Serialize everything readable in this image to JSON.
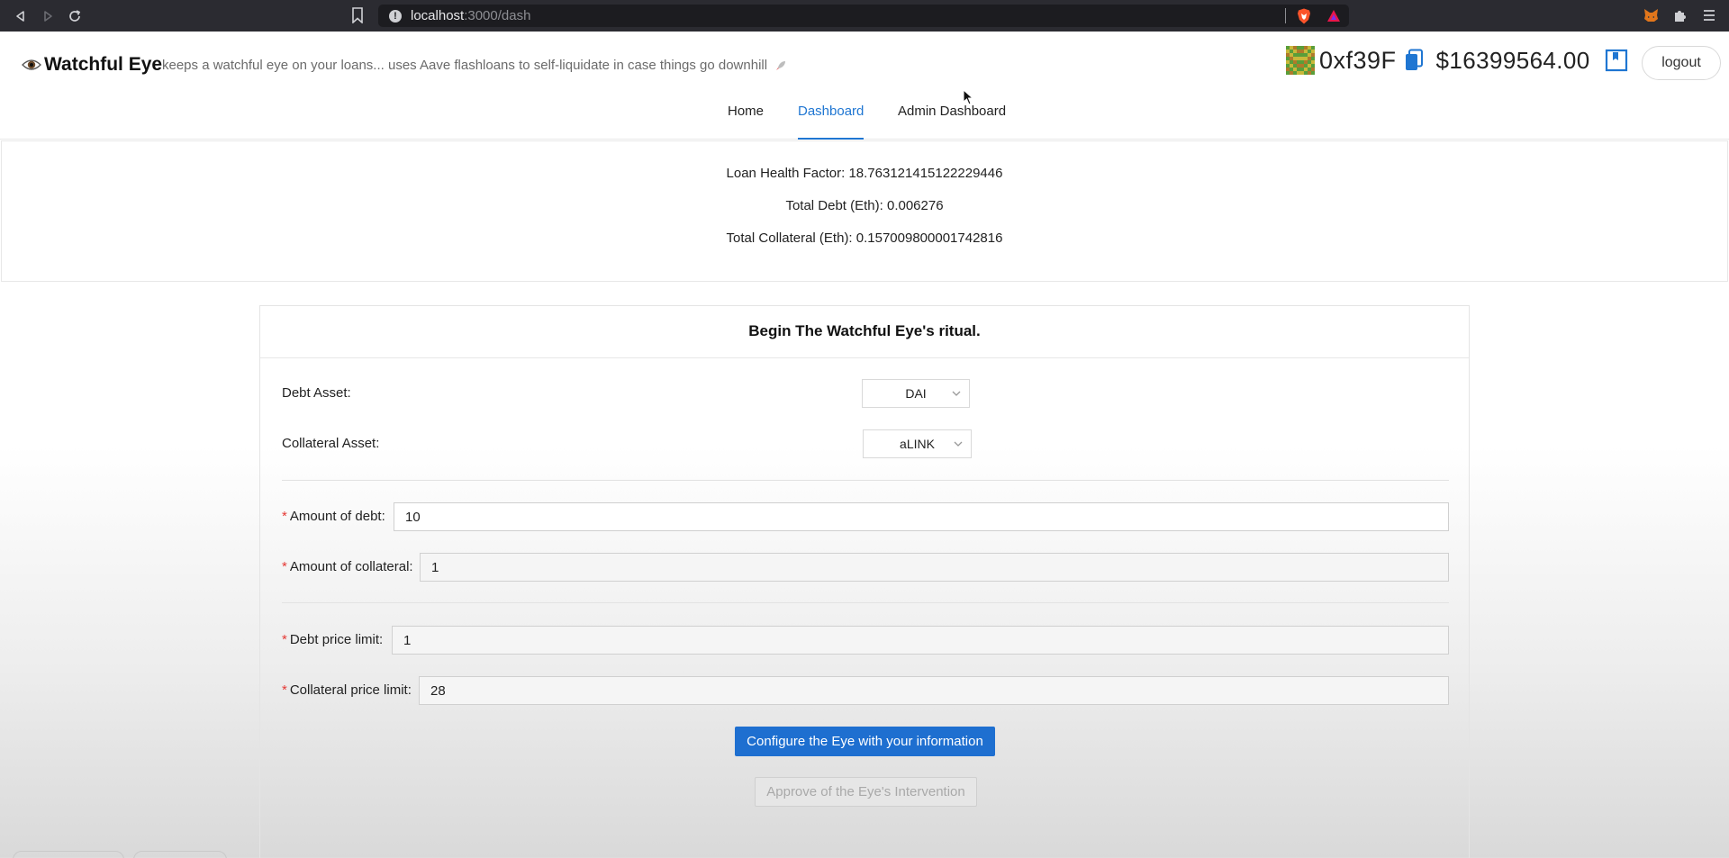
{
  "browser": {
    "url_host": "localhost",
    "url_path": ":3000/dash"
  },
  "app": {
    "title": "Watchful Eye",
    "tagline": "keeps a watchful eye on your loans... uses Aave flashloans to self-liquidate in case things go downhill",
    "address": "0xf39F",
    "balance": "$16399564.00",
    "logout_label": "logout"
  },
  "nav": {
    "tabs": [
      {
        "label": "Home",
        "active": false
      },
      {
        "label": "Dashboard",
        "active": true
      },
      {
        "label": "Admin Dashboard",
        "active": false
      }
    ]
  },
  "stats": {
    "health_factor": "Loan Health Factor: 18.763121415122229446",
    "total_debt": "Total Debt (Eth): 0.006276",
    "total_collateral": "Total Collateral (Eth): 0.157009800001742816"
  },
  "form": {
    "heading": "Begin The Watchful Eye's ritual.",
    "debt_asset_label": "Debt Asset",
    "debt_asset_value": "DAI",
    "collateral_asset_label": "Collateral Asset",
    "collateral_asset_value": "aLINK",
    "amount_debt_label": "Amount of debt",
    "amount_debt_value": "10",
    "amount_collateral_label": "Amount of collateral",
    "amount_collateral_value": "1",
    "debt_price_limit_label": "Debt price limit",
    "debt_price_limit_value": "1",
    "collateral_price_limit_label": "Collateral price limit",
    "collateral_price_limit_value": "28",
    "required_mark": "*",
    "colon": ":",
    "configure_button": "Configure the Eye with your information",
    "approve_button": "Approve of the Eye's Intervention"
  },
  "colors": {
    "accent": "#1f76d2",
    "primary_button": "#1e6fd0",
    "required": "#e53935",
    "browser_bar": "#2b2b31"
  }
}
